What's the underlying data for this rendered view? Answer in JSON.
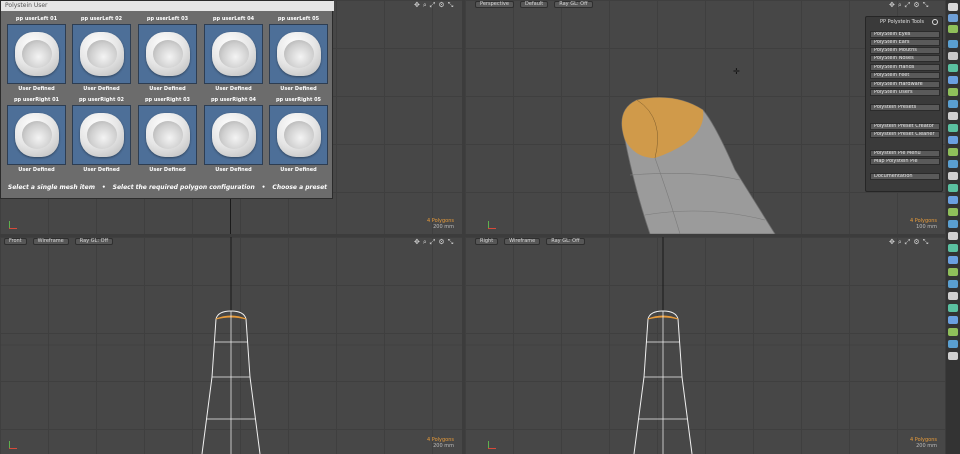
{
  "preset_panel": {
    "title": "Polystein User",
    "presets": [
      {
        "label": "pp userLeft 01",
        "caption": "User Defined"
      },
      {
        "label": "pp userLeft 02",
        "caption": "User Defined"
      },
      {
        "label": "pp userLeft 03",
        "caption": "User Defined"
      },
      {
        "label": "pp userLeft 04",
        "caption": "User Defined"
      },
      {
        "label": "pp userLeft 05",
        "caption": "User Defined"
      },
      {
        "label": "pp userRight 01",
        "caption": "User Defined"
      },
      {
        "label": "pp userRight 02",
        "caption": "User Defined"
      },
      {
        "label": "pp userRight 03",
        "caption": "User Defined"
      },
      {
        "label": "pp userRight 04",
        "caption": "User Defined"
      },
      {
        "label": "pp userRight 05",
        "caption": "User Defined"
      }
    ],
    "instructions": [
      "Select a single mesh item",
      "•",
      "Select the required polygon configuration",
      "•",
      "Choose a preset"
    ]
  },
  "viewports": {
    "top_left": {
      "poly_count": "4 Polygons",
      "size": "200 mm"
    },
    "perspective": {
      "view": "Perspective",
      "shading": "Default",
      "ray": "Ray GL: Off",
      "poly_count": "4 Polygons",
      "size": "100 mm"
    },
    "front": {
      "view": "Front",
      "shading": "Wireframe",
      "ray": "Ray GL: Off",
      "poly_count": "4 Polygons",
      "size": "200 mm"
    },
    "right": {
      "view": "Right",
      "shading": "Wireframe",
      "ray": "Ray GL: Off",
      "poly_count": "4 Polygons",
      "size": "200 mm"
    }
  },
  "tools_panel": {
    "title": "PP Polystein Tools",
    "items": [
      "PolyStein Eyes",
      "PolyStein Ears",
      "PolyStein Mouths",
      "PolyStein Noses",
      "PolyStein Hands",
      "PolyStein Feet",
      "PolyStein Hardware",
      "PolyStein Users",
      "Polystein Presets",
      "Polystein Preset Creator",
      "Polystein Preset Cleaner",
      "Polystein Pie Menu",
      "Map Polystein Pie",
      "Documentation"
    ]
  },
  "viewport_tool_icons": [
    "move-icon",
    "search-icon",
    "expand-icon",
    "gear-icon",
    "maximize-icon"
  ],
  "colors": {
    "selection": "#e89b3a",
    "viewport": "#474747",
    "preset_bg": "#4d6f98"
  }
}
